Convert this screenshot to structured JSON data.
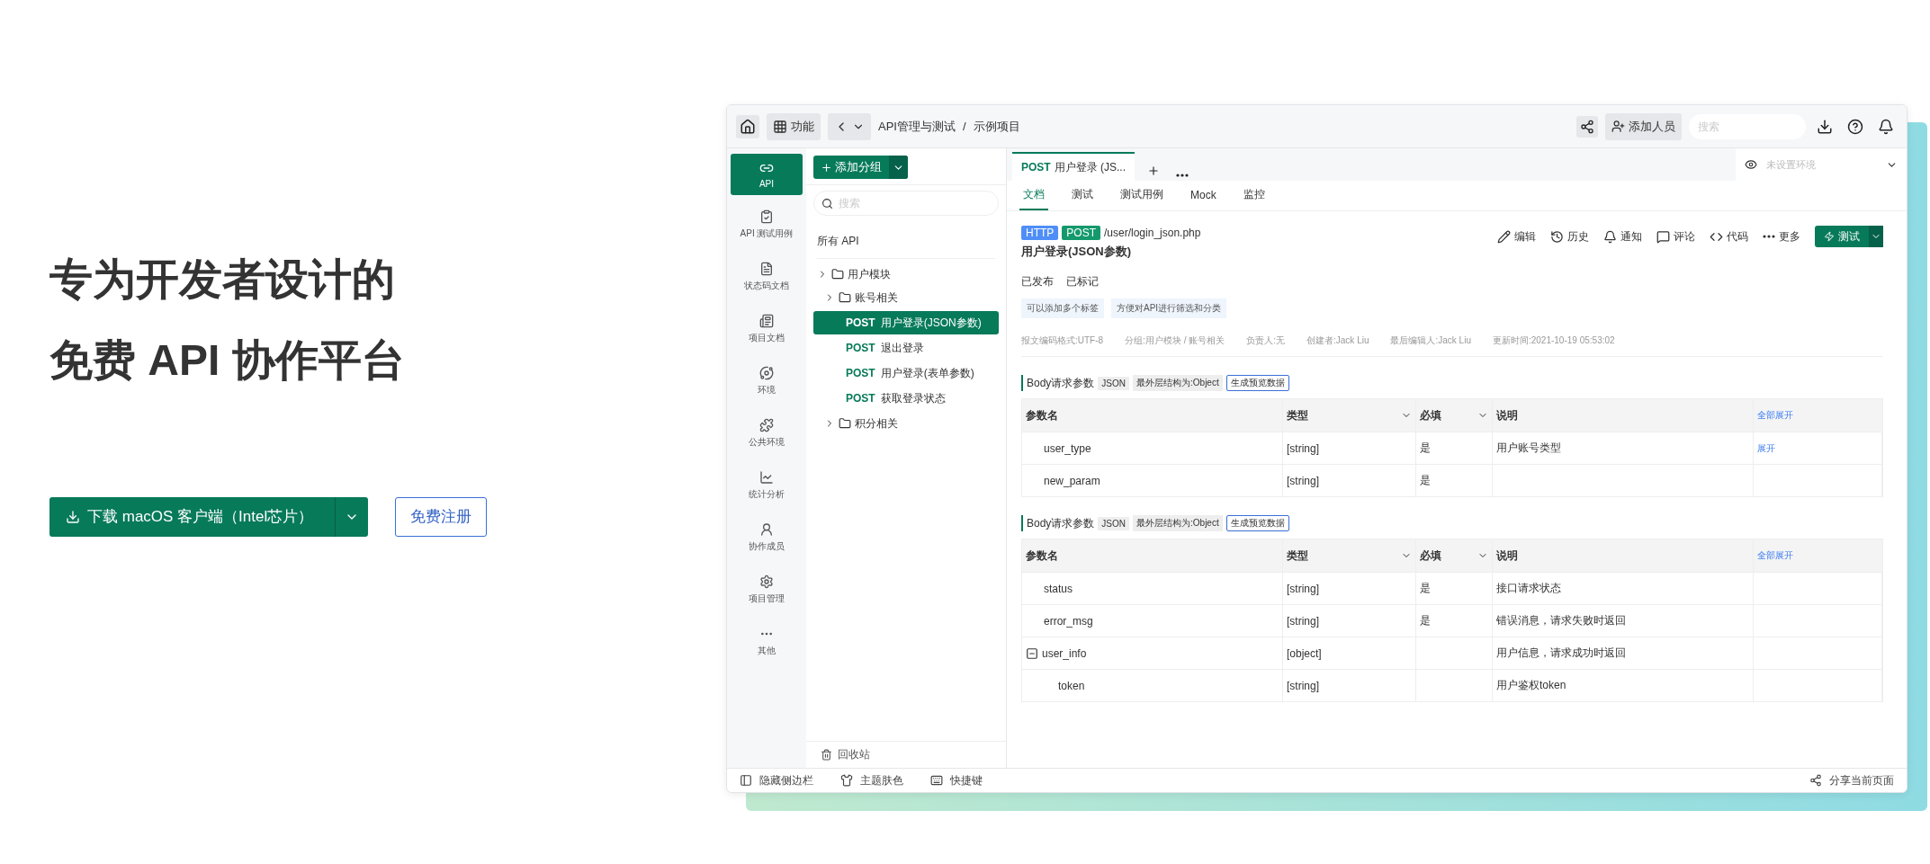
{
  "hero": {
    "title_lines": [
      "专为开发者设计的",
      "免费 API 协作平台"
    ],
    "download_button": "下载 macOS 客户端（Intel芯片）",
    "register_button": "免费注册"
  },
  "topbar": {
    "function_label": "功能",
    "breadcrumb": [
      "API管理与测试",
      "示例项目"
    ],
    "separator": "/",
    "add_member": "添加人员",
    "search_placeholder": "搜索"
  },
  "nav": [
    {
      "label": "API",
      "selected": true
    },
    {
      "label": "API 测试用例",
      "selected": false
    },
    {
      "label": "状态码文档",
      "selected": false
    },
    {
      "label": "项目文档",
      "selected": false
    },
    {
      "label": "环境",
      "selected": false
    },
    {
      "label": "公共环境",
      "selected": false
    },
    {
      "label": "统计分析",
      "selected": false
    },
    {
      "label": "协作成员",
      "selected": false
    },
    {
      "label": "项目管理",
      "selected": false
    },
    {
      "label": "其他",
      "selected": false
    }
  ],
  "tree": {
    "add_group": "添加分组",
    "search_placeholder": "搜索",
    "all_label": "所有 API",
    "recycle_bin": "回收站",
    "items": [
      {
        "kind": "folder",
        "label": "用户模块",
        "children": [
          {
            "kind": "folder",
            "label": "账号相关",
            "children": [
              {
                "kind": "api",
                "method": "POST",
                "label": "用户登录(JSON参数)",
                "selected": true
              },
              {
                "kind": "api",
                "method": "POST",
                "label": "退出登录",
                "selected": false
              },
              {
                "kind": "api",
                "method": "POST",
                "label": "用户登录(表单参数)",
                "selected": false
              },
              {
                "kind": "api",
                "method": "POST",
                "label": "获取登录状态",
                "selected": false
              }
            ]
          },
          {
            "kind": "folder",
            "label": "积分相关"
          }
        ]
      }
    ]
  },
  "tabs": [
    {
      "method": "POST",
      "label": "用户登录 (JS...",
      "selected": true
    }
  ],
  "environment": {
    "placeholder": "未设置环境"
  },
  "subtabs": [
    {
      "label": "文档",
      "selected": true
    },
    {
      "label": "测试",
      "selected": false
    },
    {
      "label": "测试用例",
      "selected": false
    },
    {
      "label": "Mock",
      "selected": false
    },
    {
      "label": "监控",
      "selected": false
    }
  ],
  "api": {
    "protocol": "HTTP",
    "method": "POST",
    "path": "/user/login_json.php",
    "title": "用户登录(JSON参数)",
    "statuses": [
      "已发布",
      "已标记"
    ],
    "tags": [
      "可以添加多个标签",
      "方便对API进行筛选和分类"
    ],
    "meta": [
      "报文编码格式:UTF-8",
      "分组:用户模块 / 账号相关",
      "负责人:无",
      "创建者:Jack Liu",
      "最后编辑人:Jack Liu",
      "更新时间:2021-10-19 05:53:02"
    ],
    "actions": [
      "编辑",
      "历史",
      "通知",
      "评论",
      "代码",
      "更多"
    ],
    "test_button": "测试"
  },
  "sections": [
    {
      "title": "Body请求参数",
      "format": "JSON",
      "structure": "最外层结构为:Object",
      "preview_button": "生成预览数据",
      "columns": [
        "参数名",
        "类型",
        "必填",
        "说明"
      ],
      "expand_all": "全部展开",
      "rows": [
        {
          "name": "user_type",
          "type": "[string]",
          "required": "是",
          "description": "用户账号类型",
          "action": "展开"
        },
        {
          "name": "new_param",
          "type": "[string]",
          "required": "是"
        }
      ]
    },
    {
      "title": "Body请求参数",
      "format": "JSON",
      "structure": "最外层结构为:Object",
      "preview_button": "生成预览数据",
      "columns": [
        "参数名",
        "类型",
        "必填",
        "说明"
      ],
      "expand_all": "全部展开",
      "rows": [
        {
          "name": "status",
          "type": "[string]",
          "required": "是",
          "description": "接口请求状态"
        },
        {
          "name": "error_msg",
          "type": "[string]",
          "required": "是",
          "description": "错误消息，请求失败时返回"
        },
        {
          "name": "user_info",
          "type": "[object]",
          "description": "用户信息，请求成功时返回",
          "expanded": true,
          "children": [
            {
              "name": "token",
              "type": "[string]",
              "description": "用户鉴权token"
            }
          ]
        }
      ]
    }
  ],
  "footer": {
    "items": [
      "隐藏侧边栏",
      "主题肤色",
      "快捷键"
    ],
    "share": "分享当前页面"
  }
}
